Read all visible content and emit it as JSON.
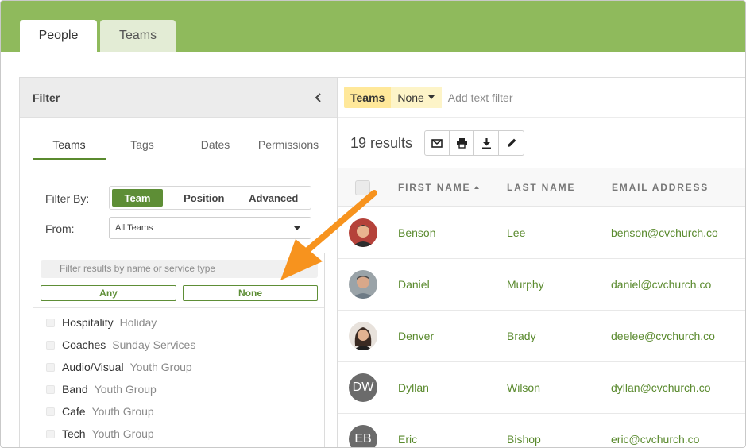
{
  "tabs": [
    {
      "label": "People"
    },
    {
      "label": "Teams"
    }
  ],
  "filter": {
    "title": "Filter",
    "sub_tabs": [
      "Teams",
      "Tags",
      "Dates",
      "Permissions"
    ],
    "filter_by_label": "Filter By:",
    "filter_by_options": [
      "Team",
      "Position",
      "Advanced"
    ],
    "from_label": "From:",
    "from_value": "All Teams",
    "search_placeholder": "Filter results by name or service type",
    "any_label": "Any",
    "none_label": "None",
    "teams": [
      {
        "name": "Hospitality",
        "type": "Holiday"
      },
      {
        "name": "Coaches",
        "type": "Sunday Services"
      },
      {
        "name": "Audio/Visual",
        "type": "Youth Group"
      },
      {
        "name": "Band",
        "type": "Youth Group"
      },
      {
        "name": "Cafe",
        "type": "Youth Group"
      },
      {
        "name": "Tech",
        "type": "Youth Group"
      }
    ]
  },
  "active_filter": {
    "field": "Teams",
    "value": "None",
    "add_text_filter": "Add text filter"
  },
  "results": {
    "count_label": "19 results",
    "actions": [
      "mail-icon",
      "print-icon",
      "download-icon",
      "edit-icon"
    ],
    "columns": [
      "FIRST NAME",
      "LAST NAME",
      "EMAIL ADDRESS"
    ],
    "rows": [
      {
        "first": "Benson",
        "last": "Lee",
        "email": "benson@cvchurch.co",
        "initials": ""
      },
      {
        "first": "Daniel",
        "last": "Murphy",
        "email": "daniel@cvchurch.co",
        "initials": ""
      },
      {
        "first": "Denver",
        "last": "Brady",
        "email": "deelee@cvchurch.co",
        "initials": ""
      },
      {
        "first": "Dyllan",
        "last": "Wilson",
        "email": "dyllan@cvchurch.co",
        "initials": "DW"
      },
      {
        "first": "Eric",
        "last": "Bishop",
        "email": "eric@cvchurch.co",
        "initials": "EB"
      }
    ]
  },
  "colors": {
    "topbar": "#8fba5c",
    "accent": "#5e8e36",
    "link": "#5a8a2e",
    "arrow": "#f7931e",
    "chip": "#ffe89a"
  }
}
